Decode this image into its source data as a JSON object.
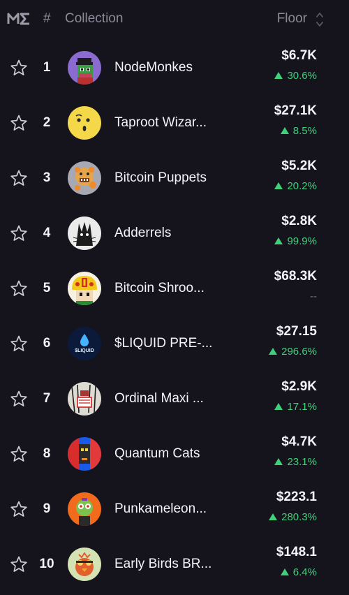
{
  "header": {
    "hash": "#",
    "collection": "Collection",
    "floor": "Floor"
  },
  "rows": [
    {
      "rank": "1",
      "name": "NodeMonkes",
      "price": "$6.7K",
      "change": "30.6%",
      "direction": "up",
      "avatar": "nodemonkes-avatar"
    },
    {
      "rank": "2",
      "name": "Taproot Wizar...",
      "price": "$27.1K",
      "change": "8.5%",
      "direction": "up",
      "avatar": "taproot-wizards-avatar"
    },
    {
      "rank": "3",
      "name": "Bitcoin Puppets",
      "price": "$5.2K",
      "change": "20.2%",
      "direction": "up",
      "avatar": "bitcoin-puppets-avatar"
    },
    {
      "rank": "4",
      "name": "Adderrels",
      "price": "$2.8K",
      "change": "99.9%",
      "direction": "up",
      "avatar": "adderrels-avatar"
    },
    {
      "rank": "5",
      "name": "Bitcoin Shroo...",
      "price": "$68.3K",
      "change": "--",
      "direction": "none",
      "avatar": "bitcoin-shrooms-avatar"
    },
    {
      "rank": "6",
      "name": "$LIQUID PRE-...",
      "price": "$27.15",
      "change": "296.6%",
      "direction": "up",
      "avatar": "liquid-avatar",
      "avatar_text": "$LIQUID"
    },
    {
      "rank": "7",
      "name": "Ordinal Maxi ...",
      "price": "$2.9K",
      "change": "17.1%",
      "direction": "up",
      "avatar": "ordinal-maxi-avatar"
    },
    {
      "rank": "8",
      "name": "Quantum Cats",
      "price": "$4.7K",
      "change": "23.1%",
      "direction": "up",
      "avatar": "quantum-cats-avatar"
    },
    {
      "rank": "9",
      "name": "Punkameleon...",
      "price": "$223.1",
      "change": "280.3%",
      "direction": "up",
      "avatar": "punkameleons-avatar"
    },
    {
      "rank": "10",
      "name": "Early Birds BR...",
      "price": "$148.1",
      "change": "6.4%",
      "direction": "up",
      "avatar": "early-birds-avatar"
    }
  ],
  "colors": {
    "background": "#15131c",
    "muted": "#8d8a99",
    "positive": "#3fd07a",
    "neutral": "#77737f"
  }
}
